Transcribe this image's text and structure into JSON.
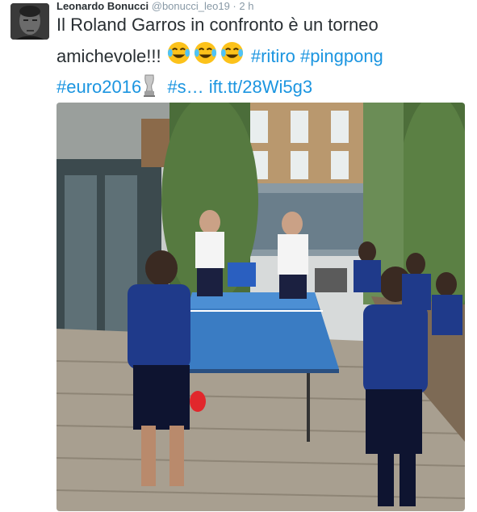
{
  "tweet": {
    "author_name": "Leonardo Bonucci",
    "handle": "@bonucci_leo19",
    "separator": "·",
    "time": "2 h",
    "text_line1": "Il Roland Garros in confronto è un torneo",
    "text_line2_start": "amichevole!!!",
    "hashtag_ritiro": "#ritiro",
    "hashtag_pingpong": "#pingpong",
    "hashtag_euro2016": "#euro2016",
    "hashtag_truncated": "#s…",
    "link": "ift.tt/28Wi5g3",
    "emojis": [
      "face-with-tears-of-joy-emoji",
      "face-with-tears-of-joy-emoji",
      "face-with-tears-of-joy-emoji"
    ]
  },
  "colors": {
    "link_blue": "#1b95e0",
    "text": "#292f33",
    "secondary_text": "#8899a6"
  }
}
